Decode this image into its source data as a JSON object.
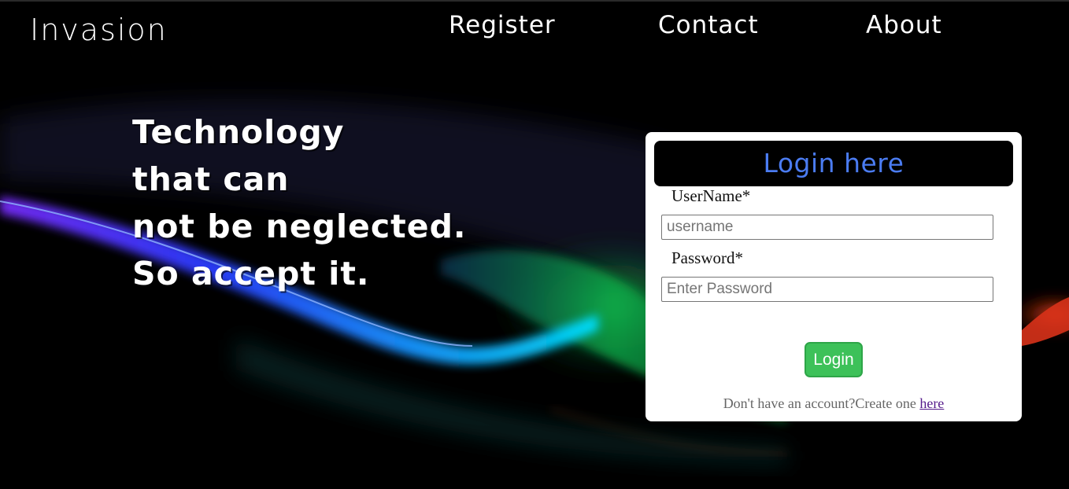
{
  "header": {
    "brand": "Invasion",
    "nav": {
      "register": "Register",
      "contact": "Contact",
      "about": "About"
    }
  },
  "hero": {
    "lines": [
      "Technology",
      "that can",
      "not be neglected.",
      "So accept it."
    ]
  },
  "login": {
    "title": "Login here",
    "username_label": "UserName*",
    "username_placeholder": "username",
    "username_value": "",
    "password_label": "Password*",
    "password_placeholder": "Enter Password",
    "password_value": "",
    "submit_label": "Login",
    "signup_prompt": "Don't have an account?Create one ",
    "signup_link": "here"
  },
  "colors": {
    "background": "#000000",
    "title_accent": "#4b7cf2",
    "button": "#3dc159",
    "link_visited": "#551a8b"
  }
}
